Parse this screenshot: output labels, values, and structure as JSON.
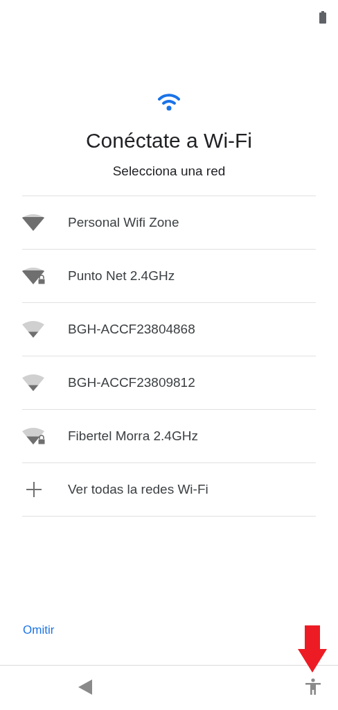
{
  "title": "Conéctate a Wi-Fi",
  "subtitle": "Selecciona una red",
  "networks": [
    {
      "kind": "strong",
      "name": "Personal Wifi Zone",
      "secured": false
    },
    {
      "kind": "strong",
      "name": "Punto Net 2.4GHz",
      "secured": true
    },
    {
      "kind": "weak",
      "name": "BGH-ACCF23804868",
      "secured": false
    },
    {
      "kind": "weak",
      "name": "BGH-ACCF23809812",
      "secured": false
    },
    {
      "kind": "fair",
      "name": "Fibertel Morra 2.4GHz",
      "secured": true
    },
    {
      "kind": "add",
      "name": "Ver todas la redes Wi-Fi"
    }
  ],
  "skip_link": "Omitir"
}
